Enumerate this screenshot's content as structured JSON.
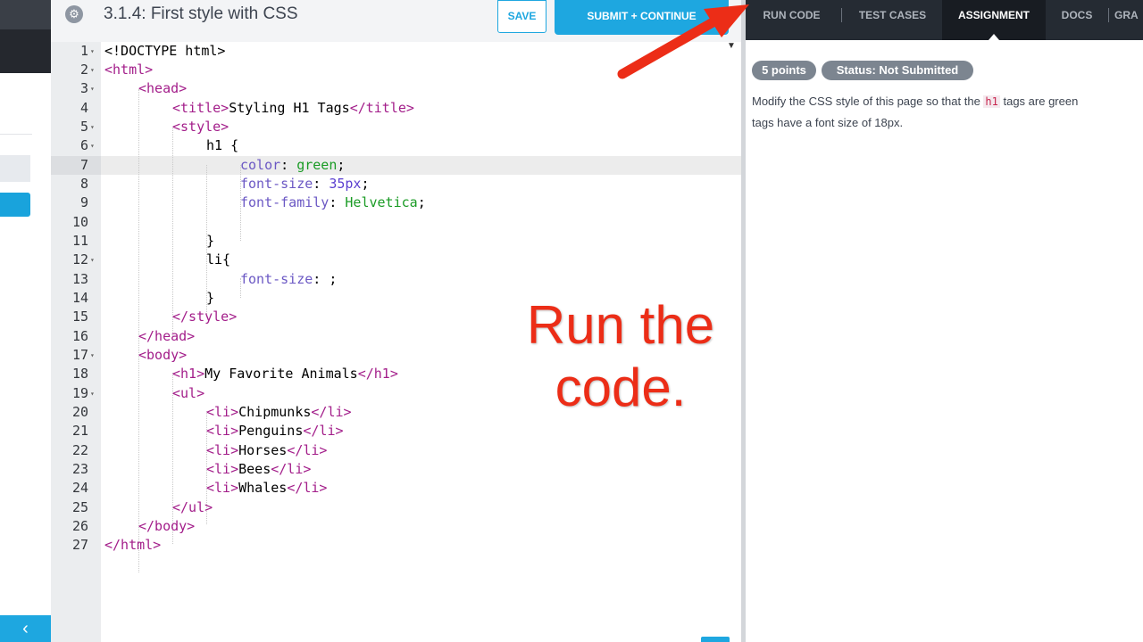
{
  "header": {
    "title": "3.1.4: First style with CSS",
    "save_label": "SAVE",
    "submit_label": "SUBMIT + CONTINUE"
  },
  "sidebar": {
    "back_icon": "chevron-left-icon"
  },
  "code_lines": [
    {
      "n": "1",
      "fold": true
    },
    {
      "n": "2",
      "fold": true
    },
    {
      "n": "3",
      "fold": true
    },
    {
      "n": "4"
    },
    {
      "n": "5",
      "fold": true
    },
    {
      "n": "6",
      "fold": true
    },
    {
      "n": "7"
    },
    {
      "n": "8"
    },
    {
      "n": "9"
    },
    {
      "n": "10"
    },
    {
      "n": "11"
    },
    {
      "n": "12",
      "fold": true
    },
    {
      "n": "13"
    },
    {
      "n": "14"
    },
    {
      "n": "15"
    },
    {
      "n": "16"
    },
    {
      "n": "17",
      "fold": true
    },
    {
      "n": "18"
    },
    {
      "n": "19",
      "fold": true
    },
    {
      "n": "20"
    },
    {
      "n": "21"
    },
    {
      "n": "22"
    },
    {
      "n": "23"
    },
    {
      "n": "24"
    },
    {
      "n": "25"
    },
    {
      "n": "26"
    },
    {
      "n": "27"
    }
  ],
  "code_text": {
    "l1": "<!DOCTYPE html>",
    "l2": "<html>",
    "l3": "<head>",
    "l4_open": "<title>",
    "l4_text": "Styling H1 Tags",
    "l4_close": "</title>",
    "l5": "<style>",
    "l6": "h1 {",
    "l7_prop": "color",
    "l7_val": "green",
    "l8_prop": "font-size",
    "l8_val": "35px",
    "l9_prop": "font-family",
    "l9_val": "Helvetica",
    "l11": "}",
    "l12": "li{",
    "l13_prop": "font-size",
    "l14": "}",
    "l15": "</style>",
    "l16": "</head>",
    "l17": "<body>",
    "l18_open": "<h1>",
    "l18_text": "My Favorite Animals",
    "l18_close": "</h1>",
    "l19": "<ul>",
    "li_open": "<li>",
    "li_close": "</li>",
    "l20": "Chipmunks",
    "l21": "Penguins",
    "l22": "Horses",
    "l23": "Bees",
    "l24": "Whales",
    "l25": "</ul>",
    "l26": "</body>",
    "l27": "</html>"
  },
  "right_panel": {
    "tabs": [
      {
        "label": "RUN CODE"
      },
      {
        "label": "TEST CASES"
      },
      {
        "label": "ASSIGNMENT",
        "active": true
      },
      {
        "label": "DOCS"
      },
      {
        "label": "GRA"
      }
    ],
    "points_badge": "5 points",
    "status_badge": "Status: Not Submitted",
    "assignment_pre": "Modify the CSS style of this page so that the ",
    "assignment_code": "h1",
    "assignment_post": " tags are green",
    "assignment_line2": "tags have a font size of 18px."
  },
  "annotation": {
    "line1": "Run the",
    "line2": "code."
  },
  "colors": {
    "accent": "#1ea7e0",
    "tag": "#a31e8a",
    "property": "#6b58c4",
    "value": "#1a9b25",
    "annotation": "#ec2d17"
  }
}
